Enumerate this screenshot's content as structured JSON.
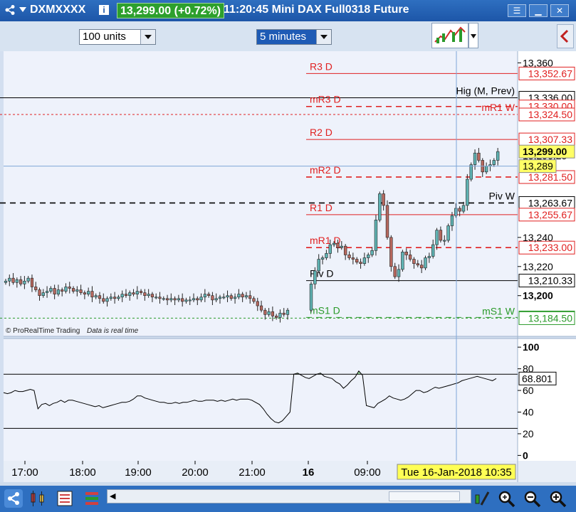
{
  "titlebar": {
    "symbol": "DXMXXXX",
    "price_change": "13,299.00 (+0.72%)",
    "time_desc": "11:20:45 Mini DAX Full0318 Future"
  },
  "toolbar": {
    "units_value": "100 units",
    "timeframe_value": "5 minutes"
  },
  "chart_data": {
    "type": "candlestick",
    "colors": {
      "up": "#5fb3b3",
      "down": "#b7685e",
      "rsi_line": "#000000",
      "rsi_fill": "#9ee09e",
      "red_line": "#e02020",
      "green_line": "#2a9a2a",
      "crosshair": "#7fa7d8"
    },
    "price_axis": {
      "ylim": [
        13172,
        13368
      ],
      "ticks": [
        13360,
        13240,
        13220,
        13200
      ]
    },
    "rsi_axis": {
      "ylim": [
        -5,
        108
      ],
      "ticks": [
        100,
        80,
        60,
        40,
        20,
        0
      ]
    },
    "time_labels": [
      "17:00",
      "18:00",
      "19:00",
      "20:00",
      "21:00",
      "16",
      "09:00"
    ],
    "cursor_label": "Tue 16-Jan-2018 10:35",
    "footer_text": [
      "© ProRealTime Trading",
      "Data is real time"
    ],
    "levels": [
      {
        "name": "R3 D",
        "value": 13352.67,
        "label": "13,352.67",
        "style": "solid",
        "color": "red",
        "from": 430
      },
      {
        "name": "Hig (M, Prev)",
        "value": 13336.0,
        "label": "13,336.00",
        "style": "solid",
        "color": "black",
        "from": 0,
        "name_right": true
      },
      {
        "name": "mR3 D",
        "value": 13330.0,
        "label": "13,330.00",
        "style": "dashed",
        "color": "red",
        "from": 430
      },
      {
        "name": "mR1 W",
        "value": 13324.5,
        "label": "13,324.50",
        "style": "dotted",
        "color": "red",
        "from": 0,
        "name_right": true
      },
      {
        "name": "R2 D",
        "value": 13307.33,
        "label": "13,307.33",
        "style": "solid",
        "color": "red",
        "from": 430
      },
      {
        "name": "mR2 D",
        "value": 13281.5,
        "label": "13,281.50",
        "style": "dashed",
        "color": "red",
        "from": 430
      },
      {
        "name": "Piv W",
        "value": 13263.67,
        "label": "13,263.67",
        "style": "dashed",
        "color": "black",
        "from": 0,
        "name_right": true
      },
      {
        "name": "R1 D",
        "value": 13255.67,
        "label": "13,255.67",
        "style": "solid",
        "color": "red",
        "from": 430
      },
      {
        "name": "mR1 D",
        "value": 13233.0,
        "label": "13,233.00",
        "style": "dashed",
        "color": "red",
        "from": 430
      },
      {
        "name": "Piv D",
        "value": 13210.33,
        "label": "13,210.33",
        "style": "solid",
        "color": "black",
        "from": 430
      },
      {
        "name": "mS1 D",
        "value": 13185.0,
        "label": "13,185.00",
        "style": "dashed",
        "color": "green",
        "from": 430
      },
      {
        "name": "mS1 W",
        "value": 13184.5,
        "label": "13,184.50",
        "style": "dotted",
        "color": "green",
        "from": 0,
        "name_right": true
      }
    ],
    "price_badges": [
      {
        "label": "13,299.00",
        "value": 13299.0
      },
      {
        "label": "13,289",
        "value": 13289.0
      }
    ],
    "price_partial_label": "13,296.25",
    "crosshair_price": 13289,
    "rsi_levels": [
      75,
      25
    ],
    "rsi_value_label": "68.801",
    "candles_night": [
      13210,
      13212,
      13209,
      13211,
      13208,
      13210,
      13212,
      13206,
      13204,
      13200,
      13202,
      13203,
      13205,
      13201,
      13204,
      13203,
      13206,
      13205,
      13203,
      13204,
      13202,
      13201,
      13203,
      13199,
      13200,
      13198,
      13196,
      13198,
      13199,
      13198,
      13199,
      13201,
      13200,
      13202,
      13201,
      13203,
      13202,
      13200,
      13201,
      13199,
      13199,
      13198,
      13198,
      13197,
      13198,
      13197,
      13198,
      13196,
      13197,
      13197,
      13198,
      13197,
      13199,
      13201,
      13200,
      13197,
      13198,
      13199,
      13199,
      13200,
      13198,
      13199,
      13201,
      13199,
      13200,
      13198,
      13196,
      13193,
      13190,
      13187,
      13189,
      13186,
      13185,
      13188,
      13187,
      13190
    ],
    "candles_day": [
      13208,
      13217,
      13225,
      13226,
      13229,
      13235,
      13236,
      13233,
      13234,
      13228,
      13226,
      13225,
      13223,
      13222,
      13226,
      13228,
      13231,
      13252,
      13270,
      13262,
      13240,
      13220,
      13213,
      13218,
      13230,
      13228,
      13225,
      13222,
      13221,
      13219,
      13226,
      13227,
      13235,
      13245,
      13238,
      13238,
      13248,
      13255,
      13260,
      13258,
      13262,
      13280,
      13290,
      13298,
      13293,
      13285,
      13289,
      13290,
      13293,
      13299
    ],
    "rsi_values": [
      58,
      57,
      58,
      60,
      59,
      59,
      60,
      61,
      60,
      43,
      47,
      48,
      46,
      48,
      49,
      51,
      49,
      51,
      51,
      50,
      49,
      48,
      47,
      46,
      45,
      46,
      44,
      45,
      46,
      47,
      48,
      49,
      49,
      50,
      52,
      55,
      55,
      53,
      52,
      51,
      50,
      49,
      49,
      48,
      48,
      49,
      48,
      49,
      49,
      50,
      51,
      50,
      50,
      51,
      51,
      51,
      50,
      51,
      50,
      51,
      52,
      51,
      52,
      52,
      52,
      51,
      49,
      47,
      43,
      38,
      34,
      31,
      30,
      32,
      36,
      40,
      75,
      76,
      74,
      72,
      71,
      73,
      75,
      76,
      73,
      72,
      71,
      68,
      66,
      62,
      65,
      69,
      72,
      78,
      74,
      46,
      45,
      44,
      48,
      50,
      52,
      55,
      53,
      52,
      51,
      52,
      54,
      57,
      60,
      60,
      58,
      59,
      61,
      63,
      62,
      63,
      64,
      65,
      66,
      67,
      69,
      70,
      71,
      72,
      73,
      72,
      71,
      70,
      69,
      71
    ]
  }
}
